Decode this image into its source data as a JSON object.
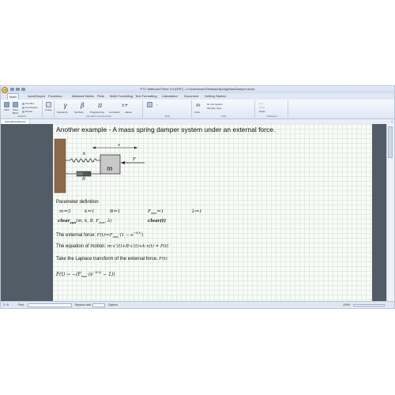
{
  "window": {
    "title": "PTC Mathcad Prime 3.0 [DRF] - C:\\Users\\user\\Desktop\\SpringMassDamper.mcdx"
  },
  "tabs": [
    "Math",
    "Input/Output",
    "Functions",
    "Matrices/Tables",
    "Plots",
    "Math Formatting",
    "Text Formatting",
    "Calculation",
    "Document",
    "Getting Started"
  ],
  "ribbon": {
    "regions_group": "Regions",
    "operators_group": "Operators and Symbols",
    "style_group": "Style",
    "units_group": "Units",
    "clipboard_group": "Clipboard",
    "buttons": {
      "math": "Math",
      "solve_block": "Solve Block",
      "text_box": "Text Box",
      "text_region": "Text Region",
      "divider": "Divider",
      "image": "Image",
      "operators": "Operators",
      "symbols": "Symbols",
      "programming": "Programming",
      "constants": "Constants",
      "labels": "Labels",
      "units": "Units",
      "unit_system": "SI Unit System",
      "simplify": "Simplify Units",
      "cut": "Cut",
      "copy": "Copy",
      "paste": "Paste"
    },
    "greek": [
      "γ",
      "β",
      "π",
      "x+"
    ]
  },
  "doc_tab": "SpringMassDamper",
  "worksheet": {
    "heading": "Another example - A mass spring damper system under an external force.",
    "diagram": {
      "x_label": "x",
      "k_label": "k",
      "B_label": "B",
      "m_label": "m",
      "F_label": "F"
    },
    "param_title": "Parameter definition",
    "params": [
      "m≔3",
      "k≔1",
      "B≔1",
      "F",
      "≔1",
      "λ≔1"
    ],
    "clear_sym": "clear",
    "clear_sym_sub": "sym",
    "clear_sym_args": "(m, k, B, F",
    "clear_sym_args_end": ", λ)",
    "clear_t": "clear(t)",
    "ext_force_label": "The external force:",
    "ext_force_expr": "F(t)≔F",
    "ext_force_rest": "·(1 − e",
    "eq_motion_label": "The equation of motion:",
    "eq_motion_expr": "m·x″(t)+B·x′(t)+k·x(t) = F(t)",
    "laplace_label": "Take the Laplace transform of the external force,",
    "laplace_label_sym": "F(t)",
    "laplace_expr": "F(t) → −(F",
    "laplace_rest": "·(e",
    "laplace_tail": " − 1))",
    "max_sub": "max",
    "exp_sup": "−(t·λ)",
    "exp_sup2": "−(t·λ)"
  },
  "status": {
    "page": "2 / 5",
    "find": "Find:",
    "replace": "Replace with:",
    "options": "Options",
    "zoom": "100%"
  },
  "colors": {
    "accent": "#1a3a6b",
    "workspace_bg": "#525c66",
    "sheet_bg": "#f9fbf9"
  }
}
